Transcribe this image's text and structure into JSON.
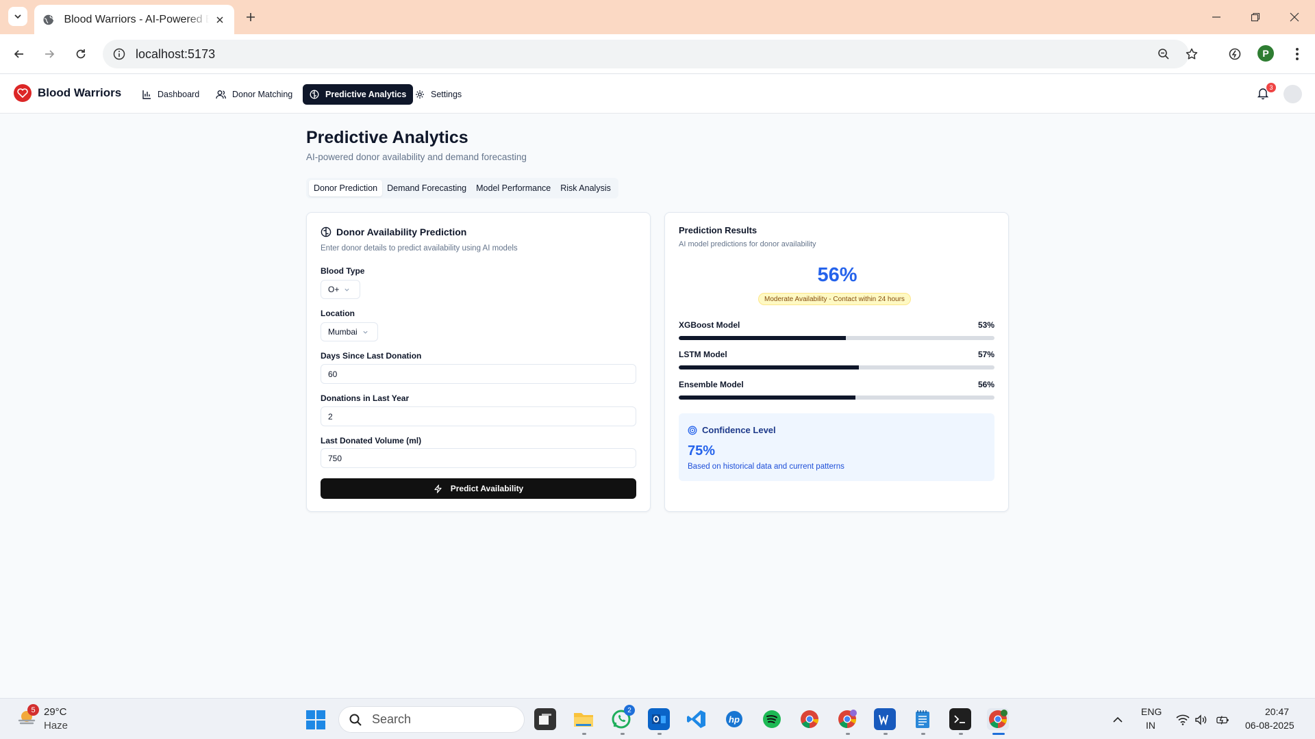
{
  "browser": {
    "tab_title": "Blood Warriors - AI-Powered Bl",
    "url": "localhost:5173",
    "profile_initial": "P"
  },
  "app": {
    "brand": "Blood Warriors",
    "nav": [
      {
        "label": "Dashboard",
        "icon": "bar-chart-icon",
        "active": false
      },
      {
        "label": "Donor Matching",
        "icon": "users-icon",
        "active": false
      },
      {
        "label": "Predictive Analytics",
        "icon": "brain-icon",
        "active": true
      },
      {
        "label": "Settings",
        "icon": "gear-icon",
        "active": false
      }
    ],
    "notification_count": "3"
  },
  "page": {
    "title": "Predictive Analytics",
    "subtitle": "AI-powered donor availability and demand forecasting",
    "tabs": [
      {
        "label": "Donor Prediction",
        "active": true
      },
      {
        "label": "Demand Forecasting",
        "active": false
      },
      {
        "label": "Model Performance",
        "active": false
      },
      {
        "label": "Risk Analysis",
        "active": false
      }
    ]
  },
  "form": {
    "title": "Donor Availability Prediction",
    "description": "Enter donor details to predict availability using AI models",
    "blood_type_label": "Blood Type",
    "blood_type_value": "O+",
    "location_label": "Location",
    "location_value": "Mumbai",
    "days_label": "Days Since Last Donation",
    "days_value": "60",
    "donations_label": "Donations in Last Year",
    "donations_value": "2",
    "volume_label": "Last Donated Volume (ml)",
    "volume_value": "750",
    "submit_label": "Predict Availability"
  },
  "results": {
    "title": "Prediction Results",
    "description": "AI model predictions for donor availability",
    "overall": "56%",
    "status_badge": "Moderate Availability - Contact within 24 hours",
    "models": [
      {
        "name": "XGBoost Model",
        "value": "53%",
        "fraction": 0.53
      },
      {
        "name": "LSTM Model",
        "value": "57%",
        "fraction": 0.57
      },
      {
        "name": "Ensemble Model",
        "value": "56%",
        "fraction": 0.56
      }
    ],
    "confidence_title": "Confidence Level",
    "confidence_value": "75%",
    "confidence_note": "Based on historical data and current patterns"
  },
  "colors": {
    "accent": "#2563eb",
    "primary_dark": "#0f172a",
    "brand_red": "#dc2626",
    "tabbar": "#fbd9c4"
  },
  "taskbar": {
    "weather_alerts": "5",
    "temperature": "29°C",
    "condition": "Haze",
    "search_placeholder": "Search",
    "whatsapp_badge": "2",
    "lang_line1": "ENG",
    "lang_line2": "IN",
    "time": "20:47",
    "date": "06-08-2025"
  }
}
